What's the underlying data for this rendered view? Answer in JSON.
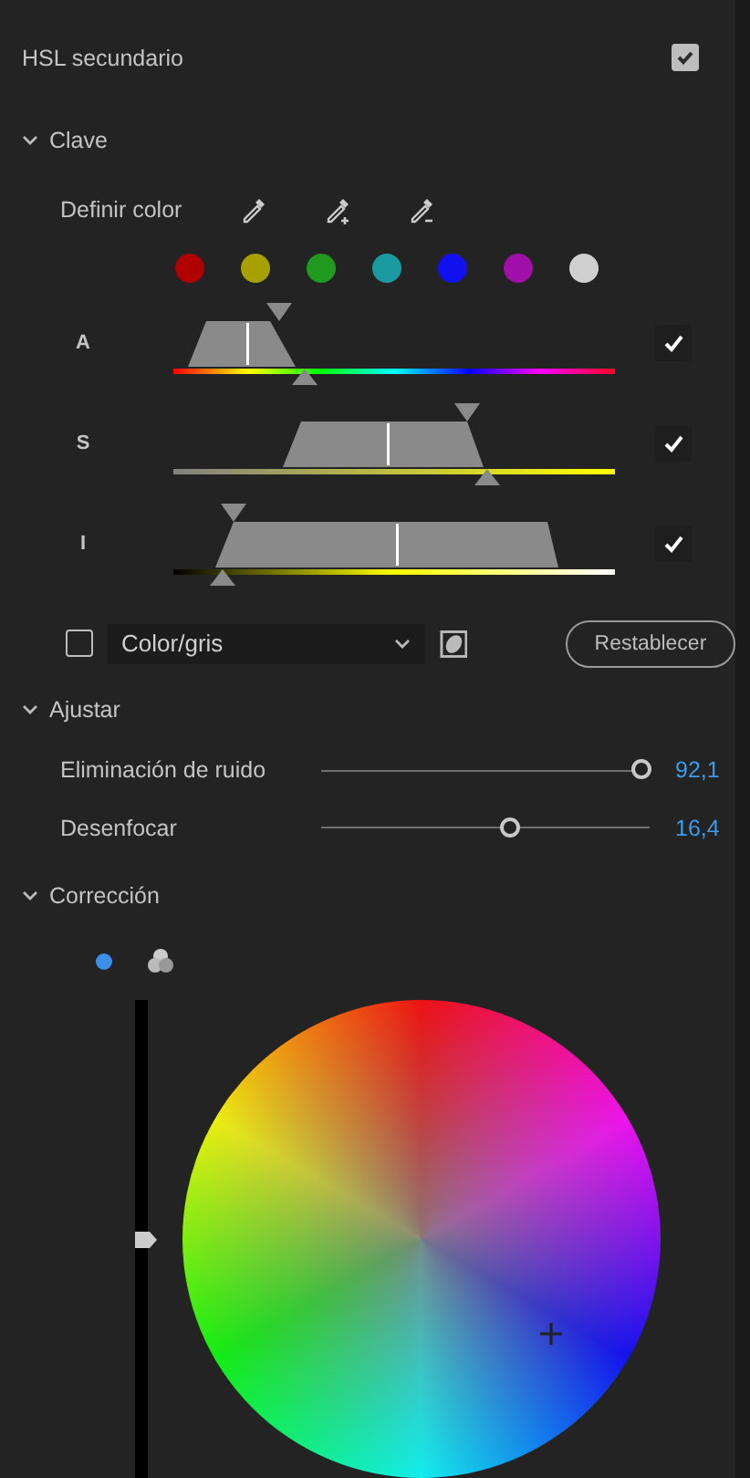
{
  "header": {
    "title": "HSL secundario",
    "checked": true
  },
  "key_section": {
    "title": "Clave",
    "expanded": true,
    "define_color_label": "Definir color",
    "swatches": [
      {
        "color": "#b00000"
      },
      {
        "color": "#a8a000"
      },
      {
        "color": "#1f9a1f"
      },
      {
        "color": "#1a9aa0"
      },
      {
        "color": "#1010f0"
      },
      {
        "color": "#a010a8"
      },
      {
        "color": "#d0d0d0"
      }
    ],
    "channels": [
      {
        "label": "A",
        "kind": "hue",
        "checked": true
      },
      {
        "label": "S",
        "kind": "saturation",
        "checked": true
      },
      {
        "label": "I",
        "kind": "luminance",
        "checked": true
      }
    ],
    "color_gray_checkbox": {
      "checked": false
    },
    "mode_dropdown": {
      "value": "Color/gris"
    },
    "reset_button": "Restablecer"
  },
  "adjust_section": {
    "title": "Ajustar",
    "expanded": true,
    "sliders": [
      {
        "label": "Eliminación de ruido",
        "level": 0.97,
        "reading": "92,1"
      },
      {
        "label": "Desenfocar",
        "level": 0.57,
        "reading": "16,4"
      }
    ]
  },
  "correction_section": {
    "title": "Corrección",
    "expanded": true,
    "modes": [
      {
        "kind": "single",
        "selected": true
      },
      {
        "kind": "three",
        "selected": false
      }
    ],
    "luminance_slider": {
      "level": 0.5
    }
  }
}
